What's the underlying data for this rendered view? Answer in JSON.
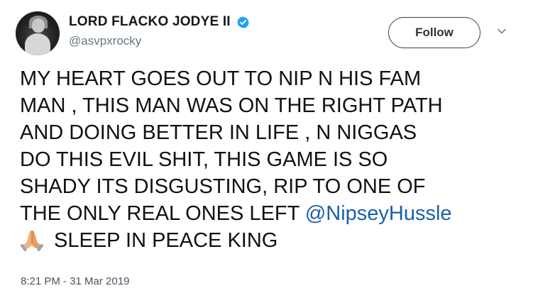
{
  "author": {
    "display_name": "LORD FLACKO JODYE II",
    "handle": "@asvpxrocky",
    "avatar_icon": "profile-avatar",
    "verified_icon": "verified-badge-icon",
    "verified_color": "#1da1f2"
  },
  "follow_button": {
    "label": "Follow"
  },
  "menu": {
    "icon": "chevron-down-icon"
  },
  "tweet": {
    "lines": [
      "MY HEART GOES OUT TO NIP N HIS FAM",
      "MAN , THIS MAN WAS ON THE RIGHT PATH",
      "AND DOING BETTER IN LIFE , N NIGGAS",
      "DO THIS EVIL SHIT, THIS GAME IS SO",
      "SHADY ITS DISGUSTING, RIP TO ONE OF"
    ],
    "line6_text": "THE ONLY REAL ONES LEFT ",
    "mention": "@NipseyHussle",
    "emoji": "folded-hands-icon",
    "line7_text": "SLEEP IN PEACE KING",
    "mention_color": "#1b5fa8"
  },
  "timestamp": "8:21 PM - 31 Mar 2019"
}
